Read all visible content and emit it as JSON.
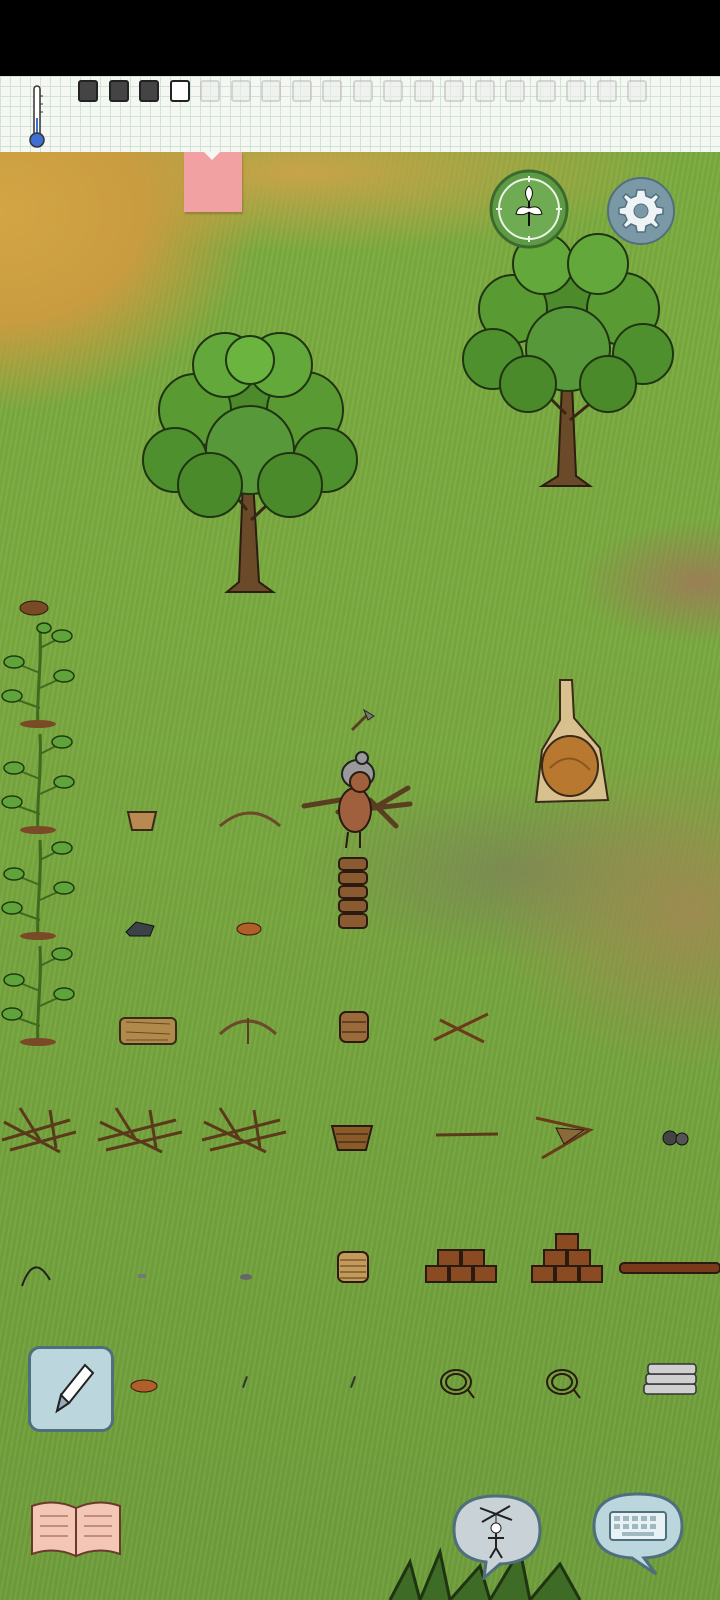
{
  "hud": {
    "thermometer_icon": "thermometer-icon",
    "inventory_slots": [
      "filled",
      "filled",
      "filled",
      "empty",
      "faint",
      "faint",
      "faint",
      "faint",
      "faint",
      "faint",
      "faint",
      "faint",
      "faint",
      "faint",
      "faint",
      "faint",
      "faint",
      "faint",
      "faint"
    ]
  },
  "buttons": {
    "tech_tree": "leaf-compass-icon",
    "settings": "gear-icon",
    "pencil": "pencil-icon",
    "book": "book-icon",
    "puppet": "puppet-icon",
    "keyboard": "keyboard-icon"
  },
  "colors": {
    "grass": "#79a83f",
    "dry_grass": "#d3a544",
    "accent_green": "#5e9a45",
    "gear_blue": "#7b98a6",
    "sticky_note": "#f2a1a2"
  }
}
